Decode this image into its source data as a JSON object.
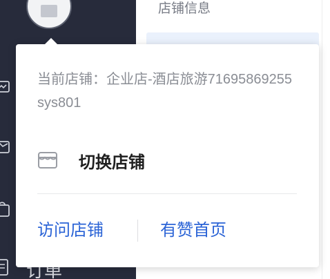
{
  "content": {
    "section_title": "店铺信息"
  },
  "sidebar": {
    "partial_label": "订单"
  },
  "popover": {
    "current_shop_label": "当前店铺：",
    "current_shop_name": "企业店-酒店旅游71695869255sys801",
    "switch_label": "切换店铺",
    "visit_link": "访问店铺",
    "home_link": "有赞首页"
  },
  "icons": {
    "shop_avatar": "shop-icon",
    "switch": "store-icon"
  },
  "colors": {
    "sidebar_bg": "#272b3b",
    "link_blue": "#2a63d6",
    "highlight": "#eaf1fc"
  }
}
